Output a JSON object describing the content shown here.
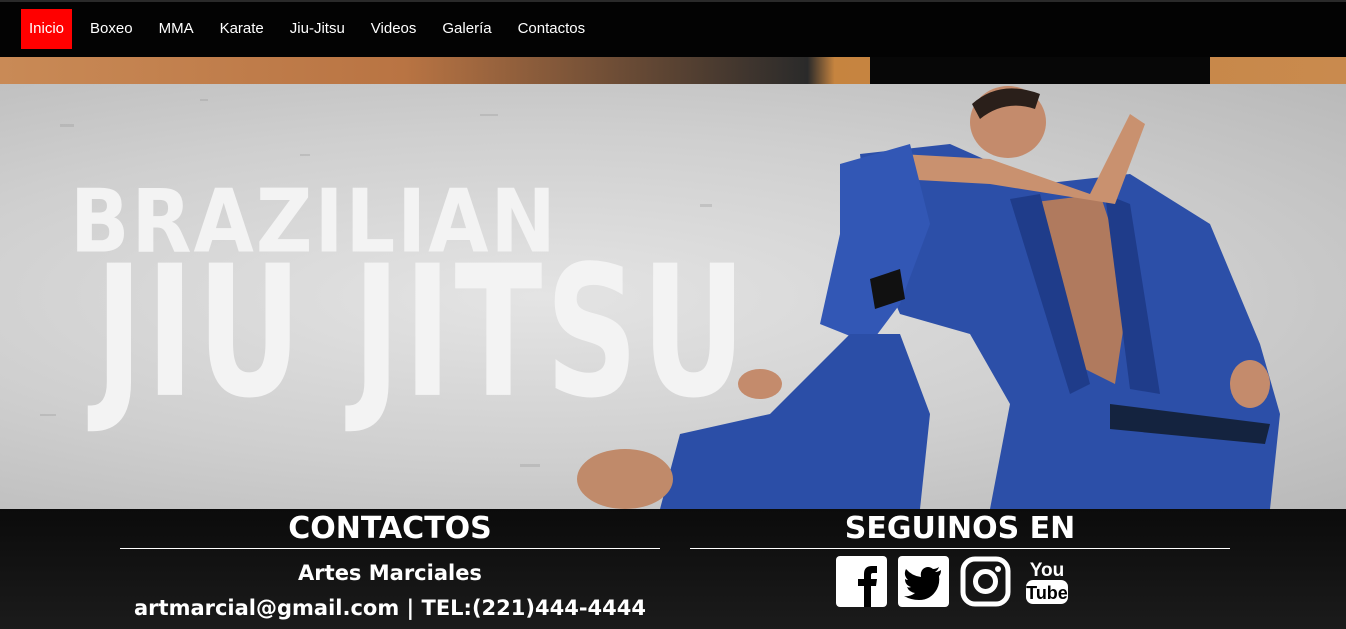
{
  "nav": {
    "items": [
      {
        "label": "Inicio",
        "active": true
      },
      {
        "label": "Boxeo",
        "active": false
      },
      {
        "label": "MMA",
        "active": false
      },
      {
        "label": "Karate",
        "active": false
      },
      {
        "label": "Jiu-Jitsu",
        "active": false
      },
      {
        "label": "Videos",
        "active": false
      },
      {
        "label": "Galería",
        "active": false
      },
      {
        "label": "Contactos",
        "active": false
      }
    ],
    "active_color": "#ff0000"
  },
  "hero": {
    "line1": "BRAZILIAN",
    "line2": "JIU JITSU"
  },
  "footer": {
    "contact_title": "CONTACTOS",
    "name": "Artes Marciales",
    "contact_line": "artmarcial@gmail.com | TEL:(221)444-4444",
    "social_title": "SEGUINOS EN",
    "social_icons": [
      "facebook-icon",
      "twitter-icon",
      "instagram-icon",
      "youtube-icon"
    ]
  }
}
